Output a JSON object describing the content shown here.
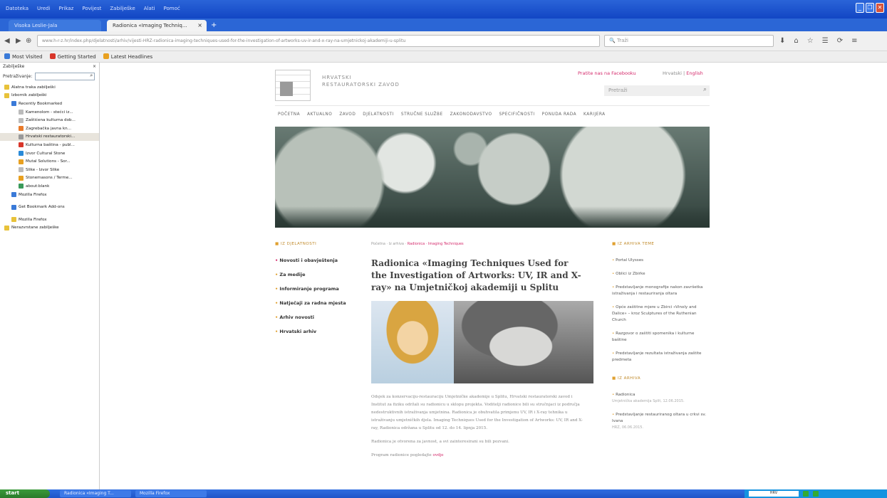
{
  "browser": {
    "menu": [
      "Datoteka",
      "Uredi",
      "Prikaz",
      "Povijest",
      "Zabilješke",
      "Alati",
      "Pomoć"
    ],
    "tabs": [
      {
        "label": "Visoka Leslie-Jala",
        "active": false
      },
      {
        "label": "Radionica «Imaging Techniq...",
        "active": true
      }
    ],
    "url": "www.h-r-z.hr/index.php/djelatnosti/arhiv/vijesti-HRZ-radionica-imaging-techniques-used-for-the-investigation-of-artworks-uv-ir-and-x-ray-na-umjetnickoj-akademiji-u-splitu",
    "search_placeholder": "Traži",
    "bookmarks": [
      {
        "label": "Most Visited",
        "color": "#3a7ad8"
      },
      {
        "label": "Getting Started",
        "color": "#d8362a"
      },
      {
        "label": "Latest Headlines",
        "color": "#e8a020"
      }
    ]
  },
  "sidebar": {
    "title": "Zabilješke",
    "search_label": "Pretraživanje:",
    "items": [
      {
        "label": "Alatna traka zabilješki",
        "indent": 0,
        "color": "#e8c23a"
      },
      {
        "label": "Izbornik zabilješki",
        "indent": 0,
        "color": "#e8c23a"
      },
      {
        "label": "Recently Bookmarked",
        "indent": 1,
        "color": "#3a7ad8"
      },
      {
        "label": "Kamenolom - stećci iz...",
        "indent": 2,
        "color": "#bbbbbb"
      },
      {
        "label": "Zaštićena kulturna dob...",
        "indent": 2,
        "color": "#bbbbbb"
      },
      {
        "label": "Zagrebačka javna kn...",
        "indent": 2,
        "color": "#e87a2a"
      },
      {
        "label": "Hrvatski restauratorski...",
        "indent": 2,
        "color": "#999999"
      },
      {
        "label": "Kulturna baština - publ...",
        "indent": 2,
        "color": "#d8362a"
      },
      {
        "label": "Izvor Cultural Stone",
        "indent": 2,
        "color": "#2a8ad8"
      },
      {
        "label": "Mutal Solutions - Sor...",
        "indent": 2,
        "color": "#e8a020"
      },
      {
        "label": "Slike - Izvor Slike",
        "indent": 2,
        "color": "#bbbbbb"
      },
      {
        "label": "Stonemasons / Terme...",
        "indent": 2,
        "color": "#e8a020"
      },
      {
        "label": "about:blank",
        "indent": 2,
        "color": "#3a9a5a"
      },
      {
        "label": "Mozilla Firefox",
        "indent": 1,
        "color": "#3a7ad8"
      },
      {
        "label": "Get Bookmark Add-ons",
        "indent": 1,
        "color": "#3a7ad8"
      },
      {
        "label": "Mozilla Firefox",
        "indent": 1,
        "color": "#e8c23a"
      },
      {
        "label": "Nerazvrstane zabilješke",
        "indent": 0,
        "color": "#e8c23a"
      }
    ]
  },
  "site": {
    "logo_text": "HRVATSKI RESTAURATORSKI ZAVOD",
    "facebook_link": "Pratite nas na Facebooku",
    "language": {
      "current": "Hrvatski",
      "separator": "|",
      "other": "English"
    },
    "search_placeholder": "Pretraži",
    "nav": [
      "POČETNA",
      "AKTUALNO",
      "ZAVOD",
      "DJELATNOSTI",
      "STRUČNE SLUŽBE",
      "ZAKONODAVSTVO",
      "SPECIFIČNOSTI",
      "PONUDA RADA",
      "KARIJERA"
    ],
    "left": {
      "title": "IZ DJELATNOSTI",
      "items": [
        "Novosti i obavještenja",
        "Za medije",
        "Informiranje programa",
        "Natječaji za radna mjesta",
        "Arhiv novosti",
        "Hrvatski arhiv"
      ]
    },
    "breadcrumb": {
      "prefix": "Početna · Iz arhiva ·",
      "current": "Radionica · Imaging Techniques"
    },
    "article": {
      "title": "Radionica «Imaging Techniques Used for the Investigation of Artworks: UV, IR and X-ray» na Umjetničkoj akademiji u Splitu",
      "paragraphs": [
        "Odsjek za konzervaciju-restauraciju Umjetničke akademije u Splitu, Hrvatski restauratorski zavod i Institut za fiziku održali su radionicu u sklopu projekta. Voditelji radionice bili su stručnjaci iz područja nedestruktivnih istraživanja umjetnina. Radionica je obuhvatila primjenu UV, IR i X-ray tehnika u istraživanju umjetničkih djela. Imaging Techniques Used for the Investigation of Artworks: UV, IR and X-ray, Radionica održana u Splitu od 12. do 14. lipnja 2015.",
        "Radionica je otvorena za javnost, a svi zainteresirani su bili pozvani."
      ],
      "link_prefix": "Program radionice pogledajte",
      "link_text": "ovdje"
    },
    "right": {
      "current_title": "IZ ARHIVA TEME",
      "current_items": [
        {
          "text": "Portal Ulysses"
        },
        {
          "text": "Oblici iz Zbirke"
        },
        {
          "text": "Predstavljanje monografije nakon završetka istraživanja i restauriranja oltara"
        },
        {
          "text": "Opće zaštitne mjere u Zbirci «Vinoly and Dalice» – kroz Sculptures of the Ruthenian Church"
        },
        {
          "text": "Razgovor o zaštiti spomenika i kulturne baštine"
        },
        {
          "text": "Predstavljanje rezultata istraživanja zaštite predmeta"
        }
      ],
      "events_title": "IZ ARHIVA",
      "events_items": [
        {
          "text": "Radionica",
          "date": "Umjetnička akademija Split, 12.06.2015."
        },
        {
          "text": "Predstavljanje restauriranog oltara u crkvi sv. Ivana",
          "date": "HRZ, 06.06.2015."
        }
      ]
    }
  },
  "taskbar": {
    "start_label": "start",
    "buttons": [
      "Radionica «Imaging T...",
      "Mozilla Firefox"
    ],
    "tray_value": "HRV"
  }
}
